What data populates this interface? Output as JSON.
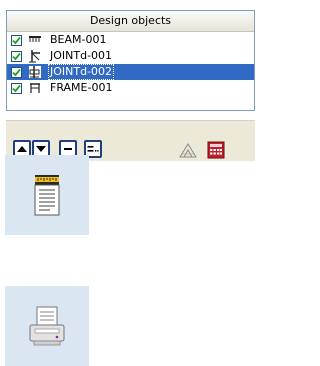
{
  "header": {
    "title": "Design objects"
  },
  "objects": [
    {
      "label": "BEAM-001",
      "icon": "beam-icon",
      "checked": true,
      "selected": false
    },
    {
      "label": "JOINTd-001",
      "icon": "joint-icon",
      "checked": true,
      "selected": false
    },
    {
      "label": "JOINTd-002",
      "icon": "joint-icon",
      "checked": true,
      "selected": true
    },
    {
      "label": "FRAME-001",
      "icon": "frame-icon",
      "checked": true,
      "selected": false
    }
  ],
  "toolbar": {
    "buttons": [
      "move-up-icon",
      "move-down-icon",
      "remove-icon",
      "properties-icon",
      "ruler-triangle-icon",
      "calculator-icon"
    ]
  },
  "side_buttons": [
    "report-icon",
    "printer-icon"
  ],
  "colors": {
    "selection": "#316ac5",
    "accent": "#1f3f7f",
    "tile": "#dbe6f3"
  }
}
